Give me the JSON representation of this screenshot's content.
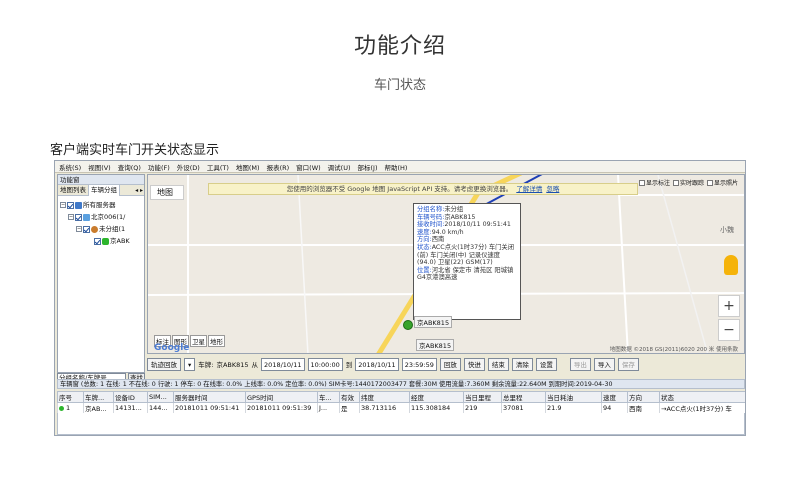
{
  "page": {
    "title": "功能介绍",
    "subtitle": "车门状态",
    "section_heading": "客户端实时车门开关状态显示"
  },
  "app": {
    "menu": [
      "系统(S)",
      "视图(V)",
      "查询(Q)",
      "功能(F)",
      "外设(D)",
      "工具(T)",
      "地图(M)",
      "报表(R)",
      "窗口(W)",
      "调试(U)",
      "部标(J)",
      "帮助(H)"
    ],
    "left_panel": {
      "title": "功能窗",
      "tabs": [
        "地图列表",
        "车辆分组"
      ],
      "arrows": "◂ ▸",
      "tree": [
        {
          "label": "所有服务器",
          "level": 0
        },
        {
          "label": "北京006(1/",
          "level": 1
        },
        {
          "label": "未分组(1",
          "level": 2
        },
        {
          "label": "京ABK",
          "level": 3
        }
      ],
      "search_combo": "分组名称/车牌号",
      "search_button": "查找"
    },
    "map": {
      "label": "地图",
      "warning_text": "您使用的浏览器不受 Google 地图 JavaScript API 支持。请考虑更换浏览器。",
      "warning_link1": "了解详情",
      "warning_link2": "忽略",
      "checks": [
        "显示标注",
        "实时跟踪",
        "显示照片"
      ],
      "city": "小魏",
      "zoom_in": "+",
      "zoom_out": "−",
      "maptypes": [
        "标注",
        "图形",
        "卫星",
        "地形"
      ],
      "google": "Google",
      "copyright": "地图数据 ©2018 GS(2011)6020  200 米  使用条款",
      "marker_label_top": "京ABK815",
      "marker_label_bottom": "京ABK815",
      "infobox": [
        {
          "k": "分组名称:",
          "v": "未分组"
        },
        {
          "k": "车辆号码:",
          "v": "京ABK815"
        },
        {
          "k": "接收时间:",
          "v": "2018/10/11 09:51:41"
        },
        {
          "k": "速度:",
          "v": "94.0 km/h"
        },
        {
          "k": "方向:",
          "v": "西南"
        },
        {
          "k": "状态:",
          "v": "ACC点火(1时37分) 车门关闭(前) 车门关闭(中) 记录仪速度(94.0) 卫星(22) GSM(17)"
        },
        {
          "k": "位置:",
          "v": "河北省 保定市 清苑区 阳城镇 G4京港澳高速"
        }
      ]
    },
    "controls": {
      "playback": "轨迹回放",
      "drop_arrow": "▾",
      "plate_label": "车牌:",
      "plate_value": "京ABK815",
      "from_label": "从",
      "from_date": "2018/10/11",
      "from_time": "10:00:00",
      "to_label": "到",
      "to_date": "2018/10/11",
      "to_time": "23:59:59",
      "buttons": [
        "回放",
        "快进",
        "结束",
        "清除",
        "设置"
      ],
      "disabled_buttons": [
        "导出"
      ],
      "right_buttons": [
        "导入"
      ],
      "save": "保存"
    },
    "grid": {
      "title": "车辆窗  (总数: 1 在线: 1 不在线: 0 行驶: 1 停车: 0 在线率: 0.0% 上线率: 0.0% 定位率: 0.0%)  SIM卡号:1440172003477 套餐:30M 使用流量:7.360M 剩余流量:22.640M 到期时间:2019-04-30",
      "headers": [
        "序号",
        "车牌...",
        "设备ID",
        "SIM...",
        "服务器时间",
        "GPS时间",
        "车...",
        "有效",
        "纬度",
        "经度",
        "当日里程",
        "总里程",
        "当日耗油",
        "速度",
        "方向",
        "状态"
      ],
      "rows": [
        [
          "1",
          "京AB...",
          "14131...",
          "144...",
          "20181011 09:51:41",
          "20181011 09:51:39",
          "J...",
          "是",
          "38.713116",
          "115.308184",
          "219",
          "37081",
          "21.9",
          "94",
          "西南",
          "→ACC点火(1时37分) 车"
        ]
      ]
    },
    "colors": {
      "accent": "#2255cc",
      "online": "#2db52d"
    }
  }
}
